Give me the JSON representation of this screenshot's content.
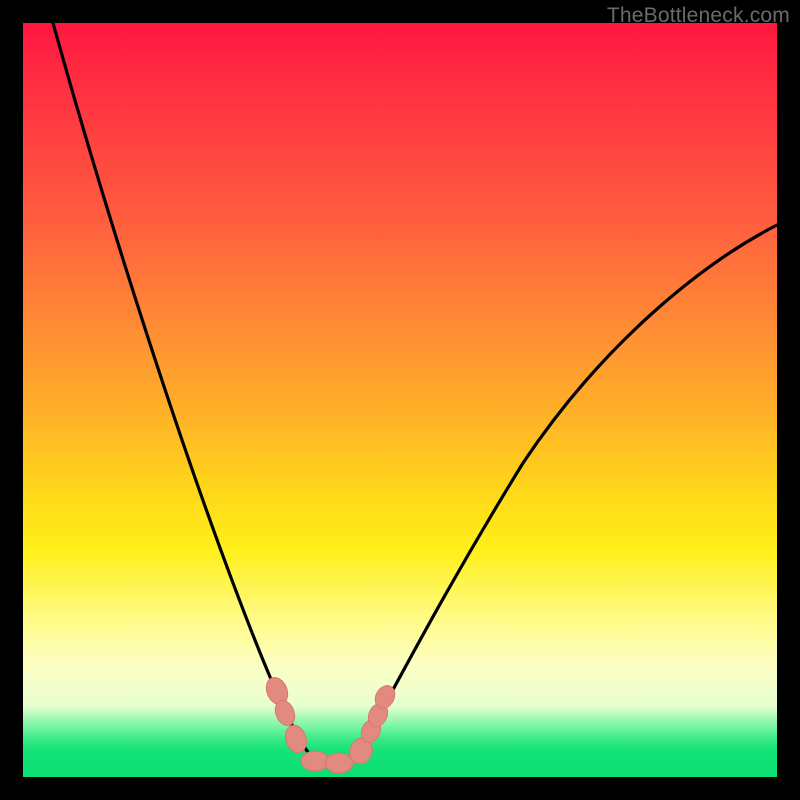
{
  "watermark": "TheBottleneck.com",
  "colors": {
    "frame": "#000000",
    "curve": "#000000",
    "marker_fill": "#e38a80",
    "marker_stroke": "#d66f67",
    "gradient_top": "#ff163e",
    "gradient_bottom": "#0bdf73"
  },
  "chart_data": {
    "type": "line",
    "title": "",
    "xlabel": "",
    "ylabel": "",
    "xlim": [
      0,
      100
    ],
    "ylim": [
      0,
      100
    ],
    "note": "No axis ticks or labels are drawn; values are pixel-estimated on a 0–100 normalized domain.",
    "series": [
      {
        "name": "left-arm",
        "x": [
          4,
          8,
          12,
          16,
          20,
          24,
          27,
          30,
          32.5,
          34.5,
          36
        ],
        "y": [
          100,
          80,
          62,
          46,
          33,
          22,
          14,
          8,
          4.5,
          2.5,
          2
        ]
      },
      {
        "name": "valley-floor",
        "x": [
          36,
          38,
          40,
          42,
          44
        ],
        "y": [
          2,
          1.6,
          1.5,
          1.6,
          2
        ]
      },
      {
        "name": "right-arm",
        "x": [
          44,
          46,
          50,
          55,
          62,
          70,
          80,
          90,
          100
        ],
        "y": [
          2,
          4,
          9,
          16,
          26,
          37,
          49,
          60,
          69
        ]
      }
    ],
    "markers": {
      "name": "cluster-near-minimum",
      "shape": "rounded-capsule",
      "points": [
        {
          "x": 33.5,
          "y": 8
        },
        {
          "x": 34.2,
          "y": 5.5
        },
        {
          "x": 35.5,
          "y": 2.5
        },
        {
          "x": 38.5,
          "y": 1.8
        },
        {
          "x": 41.5,
          "y": 1.8
        },
        {
          "x": 44.5,
          "y": 2.6
        },
        {
          "x": 45.8,
          "y": 5
        },
        {
          "x": 46.6,
          "y": 7
        },
        {
          "x": 47.4,
          "y": 9.5
        }
      ]
    }
  }
}
